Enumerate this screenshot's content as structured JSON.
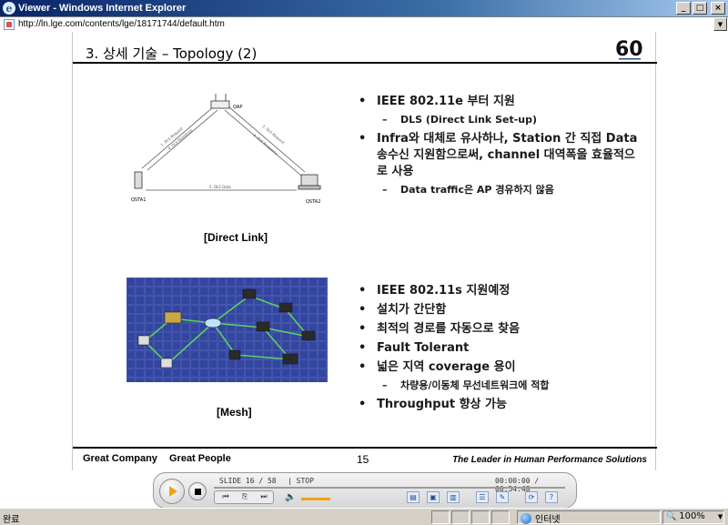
{
  "window": {
    "title": "Viewer - Windows Internet Explorer",
    "minimize": "_",
    "maximize": "□",
    "close": "×"
  },
  "address": {
    "url": "http://ln.lge.com/contents/lge/18171744/default.htm",
    "dropdown": "▼"
  },
  "slide": {
    "title": "3. 상세 기술 – Topology (2)",
    "logo_text": "60",
    "diagram_labels": {
      "qap": "QAP",
      "qsta1": "QSTA1",
      "qsta2": "QSTA2",
      "dls_request_1": "1. DLS Request",
      "dls_response_1": "4. DLS Response",
      "dls_request_2": "2. DLS Request",
      "dls_response_2": "3. DLS Response",
      "dls_data": "5. DLS Data"
    },
    "direct_link_caption": "[Direct Link]",
    "mesh_caption": "[Mesh]",
    "direct_link_bullets": [
      {
        "level": 1,
        "text": "IEEE 802.11e 부터 지원"
      },
      {
        "level": 2,
        "text": "DLS (Direct Link Set-up)"
      },
      {
        "level": 1,
        "text": "Infra와 대체로 유사하나, Station 간 직접 Data 송수신 지원함으로써, channel 대역폭을 효율적으로 사용"
      },
      {
        "level": 2,
        "text": "Data traffic은 AP 경유하지 않음"
      }
    ],
    "mesh_bullets": [
      {
        "level": 1,
        "text": "IEEE 802.11s 지원예정"
      },
      {
        "level": 1,
        "text": "설치가 간단함"
      },
      {
        "level": 1,
        "text": "최적의 경로를 자동으로 찾음"
      },
      {
        "level": 1,
        "text": "Fault Tolerant"
      },
      {
        "level": 1,
        "text": "넓은 지역 coverage 용이"
      },
      {
        "level": 2,
        "text": "차량용/이동체 무선네트워크에 적합"
      },
      {
        "level": 1,
        "text": "Throughput 향상 가능"
      }
    ],
    "footer": {
      "left_1": "Great Company",
      "left_2": "Great People",
      "page_number": "15",
      "right": "The Leader in Human Performance Solutions"
    }
  },
  "player": {
    "slide_label": "SLIDE  16 /  58",
    "state_label": "| STOP",
    "time_label": "00:00:00 / 00:54:48",
    "prev": "⏮",
    "pages": "⎘",
    "next": "⏭",
    "volume": "🔈",
    "volume_level": 0.8,
    "tool_icons": [
      "▤",
      "▣",
      "▥",
      "☰",
      "✎",
      "⟳",
      "?"
    ]
  },
  "status": {
    "text": "완료",
    "zone": "인터넷",
    "zoom": "100%",
    "zoom_icon": "🔍"
  }
}
